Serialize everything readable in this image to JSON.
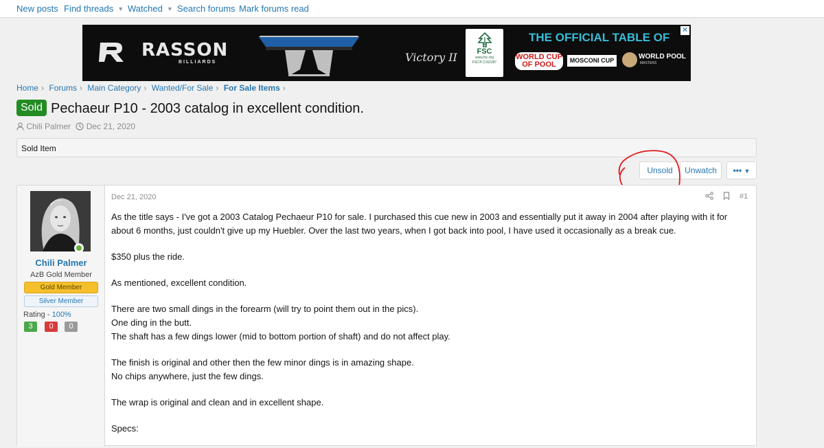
{
  "topnav": {
    "items": [
      {
        "label": "New posts",
        "caret": false
      },
      {
        "label": "Find threads",
        "caret": true
      },
      {
        "label": "Watched",
        "caret": true
      },
      {
        "label": "Search forums",
        "caret": false
      },
      {
        "label": "Mark forums read",
        "caret": false
      }
    ]
  },
  "ad": {
    "brand": "RASSON",
    "brand_sub": "BILLIARDS",
    "model": "Victory II",
    "fsc": "FSC",
    "fsc_sub": "www.fsc.org",
    "fsc_code": "FSC® C162287",
    "headline": "THE OFFICIAL TABLE OF",
    "event1": "WORLD CUP OF POOL",
    "event2": "MOSCONI CUP",
    "event3": "WORLD POOL",
    "event3_sub": "MASTERS"
  },
  "breadcrumbs": {
    "items": [
      "Home",
      "Forums",
      "Main Category",
      "Wanted/For Sale",
      "For Sale Items"
    ]
  },
  "thread": {
    "prefix": "Sold",
    "title": "Pechaeur P10 - 2003 catalog in excellent condition.",
    "author": "Chili Palmer",
    "date": "Dec 21, 2020"
  },
  "notice": {
    "text": "Sold Item"
  },
  "actions": {
    "unsold": "Unsold",
    "unwatch": "Unwatch",
    "more": "•••"
  },
  "user": {
    "name": "Chili Palmer",
    "title": "AzB Gold Member",
    "banner1": "Gold Member",
    "banner2": "Silver Member",
    "rating_label": "Rating - ",
    "rating_value": "100%",
    "positive": "3",
    "negative": "0",
    "neutral": "0"
  },
  "post": {
    "date": "Dec 21, 2020",
    "number": "#1",
    "paragraphs": [
      "As the title says - I've got a 2003 Catalog Pechaeur P10 for sale. I purchased this cue new in 2003 and essentially put it away in 2004 after playing with it for about 6 months, just couldn't give up my Huebler. Over the last two years, when I got back into pool, I have used it occasionally as a break cue.",
      "$350 plus the ride.",
      "As mentioned, excellent condition."
    ],
    "para4_lines": [
      "There are two small dings in the forearm (will try to point them out in the pics).",
      "One ding in the butt.",
      "The shaft has a few dings lower (mid to bottom portion of shaft) and do not affect play."
    ],
    "para5_lines": [
      "The finish is original and other then the few minor dings is in amazing shape.",
      "No chips anywhere, just the few dings."
    ],
    "para6": "The wrap is original and clean and in excellent shape.",
    "para7": "Specs:"
  },
  "colors": {
    "link": "#2577b1",
    "sold_badge": "#228b22",
    "gold_banner": "#f5c02b",
    "annotation_red": "#e01b1b"
  }
}
